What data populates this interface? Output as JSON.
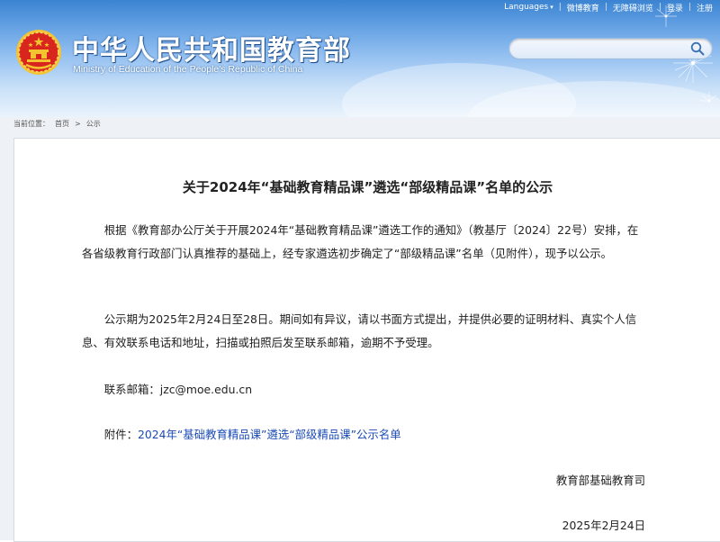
{
  "topbar": {
    "languages": "Languages",
    "weibo": "微博教育",
    "accessibility": "无障碍浏览",
    "login": "登录",
    "register": "注册"
  },
  "header": {
    "title_cn": "中华人民共和国教育部",
    "title_en": "Ministry of Education of the People's Republic of China"
  },
  "search": {
    "placeholder": ""
  },
  "breadcrumb": {
    "label": "当前位置：",
    "home": "首页",
    "separator": ">",
    "current": "公示"
  },
  "article": {
    "title": "关于2024年“基础教育精品课”遴选“部级精品课”名单的公示",
    "p1": "根据《教育部办公厅关于开展2024年“基础教育精品课”遴选工作的通知》（教基厅〔2024〕22号）安排，在各省级教育行政部门认真推荐的基础上，经专家遴选初步确定了“部级精品课”名单（见附件），现予以公示。",
    "p2": "公示期为2025年2月24日至28日。期间如有异议，请以书面方式提出，并提供必要的证明材料、真实个人信息、有效联系电话和地址，扫描或拍照后发至联系邮箱，逾期不予受理。",
    "email_label": "联系邮箱：",
    "email": "jzc@moe.edu.cn",
    "attach_label": "附件：",
    "attach_link": "2024年“基础教育精品课”遴选“部级精品课”公示名单",
    "signature": "教育部基础教育司",
    "date": "2025年2月24日"
  },
  "colors": {
    "header_blue": "#3b83d1",
    "title_shadow": "#1d4f8e",
    "link": "#1a4bb5",
    "emblem_red": "#d8261f",
    "emblem_gold": "#f4c430"
  }
}
